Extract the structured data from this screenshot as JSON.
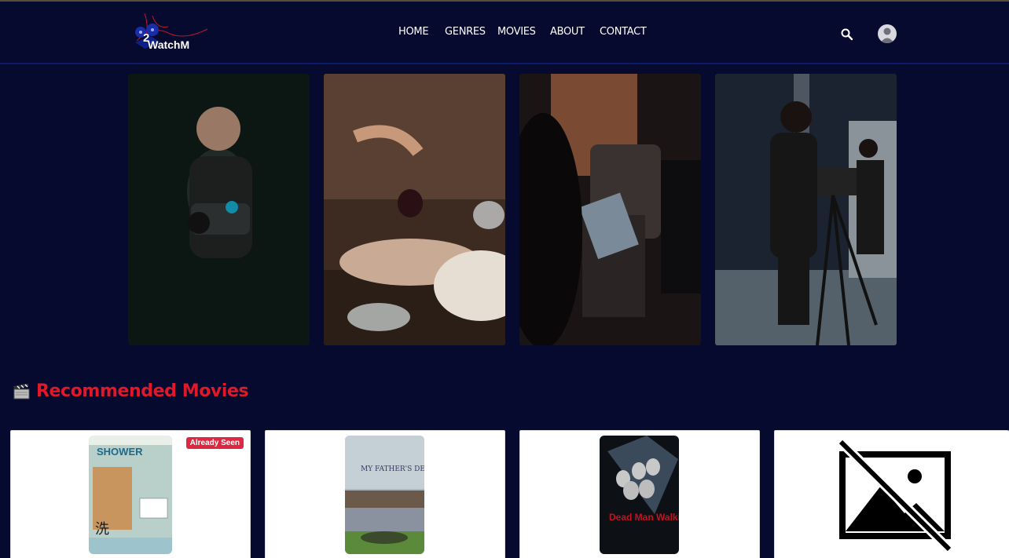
{
  "brand": {
    "logo_text": "WatchM",
    "logo_digit": "2"
  },
  "nav": {
    "items": [
      "HOME",
      "GENRES",
      "MOVIES",
      "ABOUT",
      "CONTACT"
    ]
  },
  "icons": {
    "search": "search-icon",
    "account": "user-avatar-icon"
  },
  "hero": {
    "images": [
      "videographer-with-camera",
      "woman-eating-grapes",
      "man-holding-dvd",
      "woman-with-camera-tripod"
    ]
  },
  "recommended": {
    "title": "Recommended Movies",
    "icon": "clapperboard-icon",
    "movies": [
      {
        "poster_title": "SHOWER",
        "badge": "Already Seen"
      },
      {
        "poster_title": "MY FATHER'S DEN"
      },
      {
        "poster_title": "Dead Man Walking"
      },
      {
        "poster_title": "",
        "placeholder": "image-unavailable-icon"
      }
    ]
  },
  "colors": {
    "background": "#050a2e",
    "accent": "#e0182a",
    "badge": "#dc2840"
  }
}
